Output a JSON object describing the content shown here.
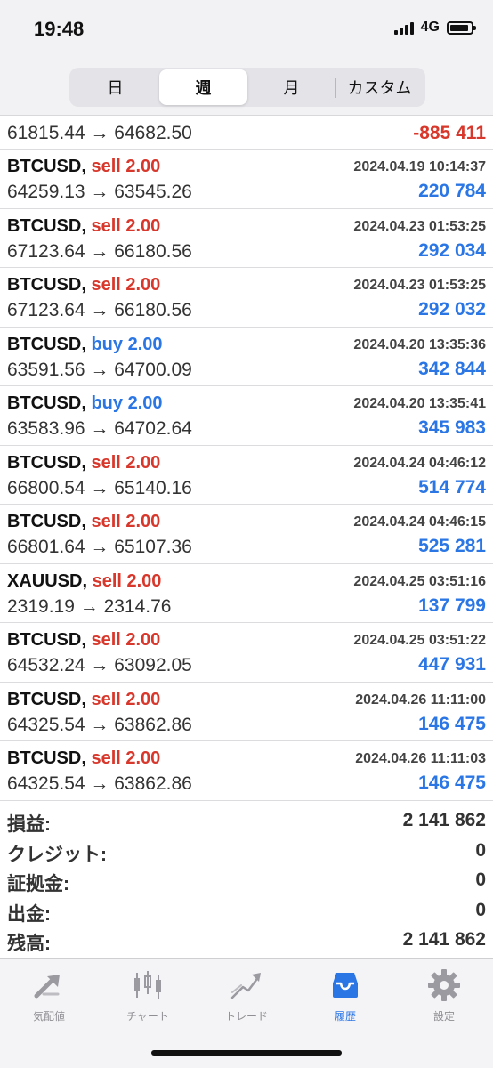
{
  "status": {
    "time": "19:48",
    "network": "4G"
  },
  "segments": [
    {
      "label": "日",
      "active": false
    },
    {
      "label": "週",
      "active": true
    },
    {
      "label": "月",
      "active": false
    },
    {
      "label": "カスタム",
      "active": false
    }
  ],
  "partial_row": {
    "prices": "61815.44 → 64682.50",
    "profit": "-885 411"
  },
  "trades": [
    {
      "symbol": "BTCUSD,",
      "side": "sell 2.00",
      "type": "sell",
      "date": "2024.04.19 10:14:37",
      "prices": "64259.13 → 63545.26",
      "profit": "220 784"
    },
    {
      "symbol": "BTCUSD,",
      "side": "sell 2.00",
      "type": "sell",
      "date": "2024.04.23 01:53:25",
      "prices": "67123.64 → 66180.56",
      "profit": "292 034"
    },
    {
      "symbol": "BTCUSD,",
      "side": "sell 2.00",
      "type": "sell",
      "date": "2024.04.23 01:53:25",
      "prices": "67123.64 → 66180.56",
      "profit": "292 032"
    },
    {
      "symbol": "BTCUSD,",
      "side": "buy 2.00",
      "type": "buy",
      "date": "2024.04.20 13:35:36",
      "prices": "63591.56 → 64700.09",
      "profit": "342 844"
    },
    {
      "symbol": "BTCUSD,",
      "side": "buy 2.00",
      "type": "buy",
      "date": "2024.04.20 13:35:41",
      "prices": "63583.96 → 64702.64",
      "profit": "345 983"
    },
    {
      "symbol": "BTCUSD,",
      "side": "sell 2.00",
      "type": "sell",
      "date": "2024.04.24 04:46:12",
      "prices": "66800.54 → 65140.16",
      "profit": "514 774"
    },
    {
      "symbol": "BTCUSD,",
      "side": "sell 2.00",
      "type": "sell",
      "date": "2024.04.24 04:46:15",
      "prices": "66801.64 → 65107.36",
      "profit": "525 281"
    },
    {
      "symbol": "XAUUSD,",
      "side": "sell 2.00",
      "type": "sell",
      "date": "2024.04.25 03:51:16",
      "prices": "2319.19 → 2314.76",
      "profit": "137 799"
    },
    {
      "symbol": "BTCUSD,",
      "side": "sell 2.00",
      "type": "sell",
      "date": "2024.04.25 03:51:22",
      "prices": "64532.24 → 63092.05",
      "profit": "447 931"
    },
    {
      "symbol": "BTCUSD,",
      "side": "sell 2.00",
      "type": "sell",
      "date": "2024.04.26 11:11:00",
      "prices": "64325.54 → 63862.86",
      "profit": "146 475"
    },
    {
      "symbol": "BTCUSD,",
      "side": "sell 2.00",
      "type": "sell",
      "date": "2024.04.26 11:11:03",
      "prices": "64325.54 → 63862.86",
      "profit": "146 475"
    }
  ],
  "summary": [
    {
      "label": "損益:",
      "value": "2 141 862"
    },
    {
      "label": "クレジット:",
      "value": "0"
    },
    {
      "label": "証拠金:",
      "value": "0"
    },
    {
      "label": "出金:",
      "value": "0"
    },
    {
      "label": "残高:",
      "value": "2 141 862"
    }
  ],
  "tabs": [
    {
      "label": "気配値",
      "icon": "quotes-arrows-icon",
      "active": false
    },
    {
      "label": "チャート",
      "icon": "candlestick-chart-icon",
      "active": false
    },
    {
      "label": "トレード",
      "icon": "trade-trend-icon",
      "active": false
    },
    {
      "label": "履歴",
      "icon": "history-inbox-icon",
      "active": true
    },
    {
      "label": "設定",
      "icon": "gear-icon",
      "active": false
    }
  ],
  "colors": {
    "sell": "#d8372b",
    "buy": "#2b76e5",
    "profit": "#2b76e5",
    "loss": "#d8372b",
    "active_tab": "#2b76e5",
    "inactive_tab": "#9a9aa0"
  }
}
